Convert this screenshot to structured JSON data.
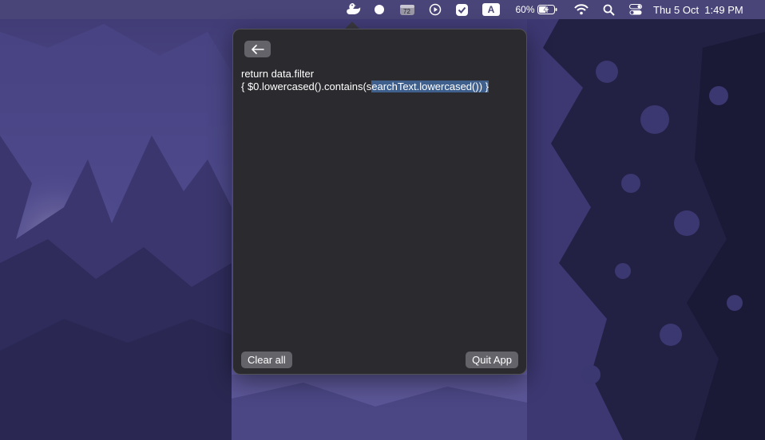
{
  "menubar": {
    "badge_count": "72",
    "keyboard_input": "A",
    "battery_percent": "60%",
    "clock": "Thu 5 Oct  1:49 PM"
  },
  "popover": {
    "content_line1": "return data.filter",
    "content_line2_plain": "{ $0.lowercased().contains(s",
    "content_line2_selected": "earchText.lowercased()) }",
    "clear_button": "Clear all",
    "quit_button": "Quit App"
  },
  "colors": {
    "popover_bg": "#2b2a2f",
    "button_bg": "#646369",
    "selection": "#3f5f8d",
    "menubar": "#4a4678"
  },
  "icons": [
    "duck-icon",
    "record-icon",
    "badge-app-icon",
    "play-icon",
    "checkmark-icon",
    "keyboard-input-icon",
    "battery-charging-icon",
    "wifi-icon",
    "search-icon",
    "control-center-icon",
    "back-arrow-icon"
  ]
}
